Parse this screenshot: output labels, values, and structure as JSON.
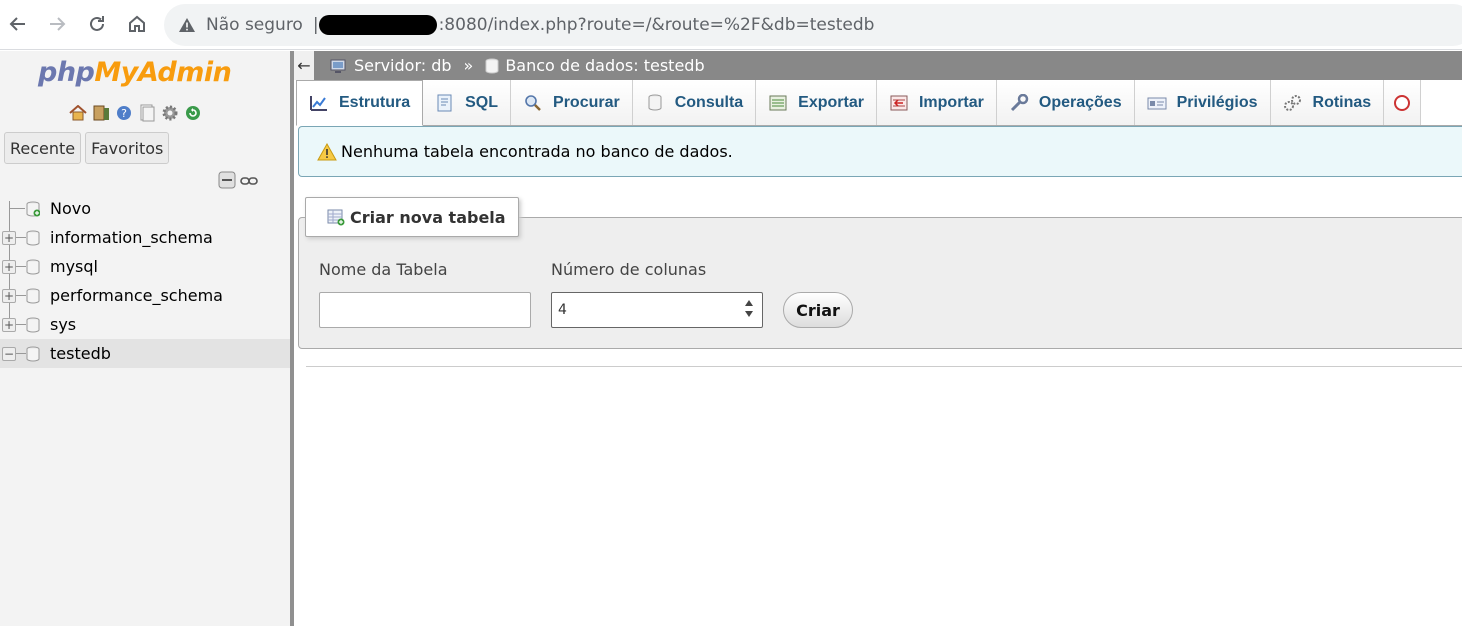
{
  "browser": {
    "not_secure": "Não seguro",
    "separator": "|",
    "url": ":8080/index.php?route=/&route=%2F&db=testedb"
  },
  "nav": {
    "logo": {
      "php": "php",
      "my": "My",
      "admin": "Admin"
    },
    "recent_label": "Recente",
    "favorites_label": "Favoritos",
    "tree": [
      {
        "label": "Novo",
        "type": "new"
      },
      {
        "label": "information_schema",
        "type": "db",
        "expanded": false
      },
      {
        "label": "mysql",
        "type": "db",
        "expanded": false
      },
      {
        "label": "performance_schema",
        "type": "db",
        "expanded": false
      },
      {
        "label": "sys",
        "type": "db",
        "expanded": false
      },
      {
        "label": "testedb",
        "type": "db",
        "expanded": true,
        "selected": true
      }
    ]
  },
  "breadcrumb": {
    "server": "Servidor: db",
    "separator": "»",
    "database": "Banco de dados: testedb"
  },
  "tabs": [
    {
      "label": "Estrutura",
      "icon": "structure-icon",
      "active": true
    },
    {
      "label": "SQL",
      "icon": "sql-icon"
    },
    {
      "label": "Procurar",
      "icon": "search-icon"
    },
    {
      "label": "Consulta",
      "icon": "query-icon"
    },
    {
      "label": "Exportar",
      "icon": "export-icon"
    },
    {
      "label": "Importar",
      "icon": "import-icon"
    },
    {
      "label": "Operações",
      "icon": "wrench-icon"
    },
    {
      "label": "Privilégios",
      "icon": "privileges-icon"
    },
    {
      "label": "Rotinas",
      "icon": "routines-icon"
    }
  ],
  "notice": {
    "text": "Nenhuma tabela encontrada no banco de dados."
  },
  "create_table": {
    "legend": "Criar nova tabela",
    "name_label": "Nome da Tabela",
    "name_value": "",
    "columns_label": "Número de colunas",
    "columns_value": "4",
    "submit_label": "Criar"
  },
  "colors": {
    "tab_text": "#235a81",
    "breadcrumb_bg": "#888888",
    "notice_bg": "#ebf8fa",
    "logo_php": "#6c78af",
    "logo_admin": "#f89c0e"
  }
}
